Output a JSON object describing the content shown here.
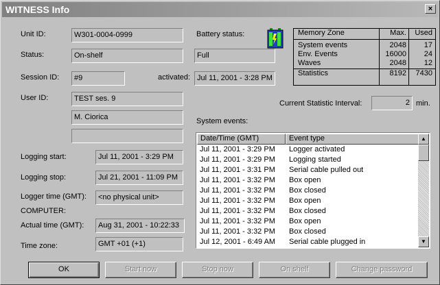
{
  "window": {
    "title": "WITNESS Info",
    "close_label": "×"
  },
  "unit": {
    "unit_id_label": "Unit ID:",
    "unit_id": "W301-0004-0999",
    "status_label": "Status:",
    "status": "On-shelf",
    "session_id_label": "Session ID:",
    "session_id": "#9",
    "activated_label": "activated:",
    "activated": "Jul 11, 2001 - 3:28 PM",
    "user_id_label": "User ID:",
    "user_id": "TEST ses. 9",
    "user_name": "M. Ciorica",
    "user_extra": "",
    "logging_start_label": "Logging start:",
    "logging_start": "Jul 11, 2001 - 3:29 PM",
    "logging_stop_label": "Logging stop:",
    "logging_stop": "Jul 21, 2001 - 11:09 PM",
    "logger_time_label": "Logger time (GMT):",
    "logger_time": "<no physical unit>",
    "computer_label": "COMPUTER:",
    "actual_time_label": "Actual time (GMT):",
    "actual_time": "Aug 31, 2001 - 10:22:33",
    "time_zone_label": "Time zone:",
    "time_zone": "GMT +01 (+1)"
  },
  "battery": {
    "label": "Battery status:",
    "value": "Full",
    "icon": "battery-icon"
  },
  "memory": {
    "headers": [
      "Memory Zone",
      "Max.",
      "Used"
    ],
    "rows": [
      {
        "zone": "System events",
        "max": "2048",
        "used": "17"
      },
      {
        "zone": "Env. Events",
        "max": "16000",
        "used": "24"
      },
      {
        "zone": "Waves",
        "max": "2048",
        "used": "12"
      },
      {
        "zone": "Statistics",
        "max": "8192",
        "used": "7430"
      }
    ]
  },
  "statistic": {
    "label": "Current Statistic Interval:",
    "value": "2",
    "unit": "min."
  },
  "events": {
    "label": "System events:",
    "headers": [
      "Date/Time (GMT)",
      "Event type"
    ],
    "rows": [
      {
        "time": "Jul 11, 2001 - 3:29 PM",
        "type": "Logger activated"
      },
      {
        "time": "Jul 11, 2001 - 3:29 PM",
        "type": "Logging started"
      },
      {
        "time": "Jul 11, 2001 - 3:31 PM",
        "type": "Serial cable pulled out"
      },
      {
        "time": "Jul 11, 2001 - 3:32 PM",
        "type": "Box open"
      },
      {
        "time": "Jul 11, 2001 - 3:32 PM",
        "type": "Box closed"
      },
      {
        "time": "Jul 11, 2001 - 3:32 PM",
        "type": "Box open"
      },
      {
        "time": "Jul 11, 2001 - 3:32 PM",
        "type": "Box closed"
      },
      {
        "time": "Jul 11, 2001 - 3:32 PM",
        "type": "Box open"
      },
      {
        "time": "Jul 11, 2001 - 3:32 PM",
        "type": "Box closed"
      },
      {
        "time": "Jul 12, 2001 - 6:49 AM",
        "type": "Serial cable plugged in"
      }
    ]
  },
  "buttons": {
    "ok": "OK",
    "start_now": "Start now",
    "stop_now": "Stop now",
    "on_shelf": "On shelf",
    "change_password": "Change password"
  },
  "colors": {
    "title_gradient_start": "#808080",
    "dialog_bg": "#c0c0c0",
    "battery_fill": "#2040c0",
    "battery_terminal": "#00a000"
  }
}
